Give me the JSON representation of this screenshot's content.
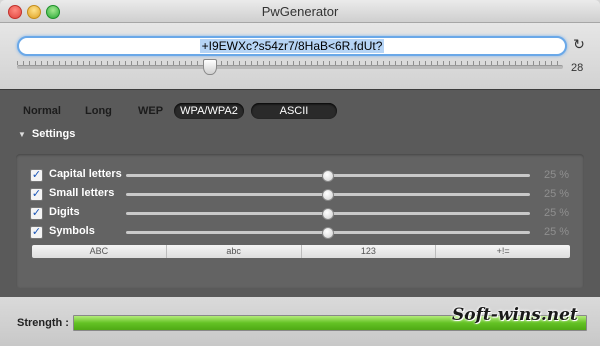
{
  "window": {
    "title": "PwGenerator"
  },
  "password": {
    "value": "+I9EWXc?s54zr7/8HaB<6R.fdUt?"
  },
  "length": {
    "value": "28",
    "fraction": 0.35
  },
  "modes": {
    "normal": "Normal",
    "long": "Long",
    "wep": "WEP",
    "wpa": "WPA/WPA2",
    "ascii": "ASCII"
  },
  "settings": {
    "title": "Settings",
    "rows": [
      {
        "label": "Capital letters",
        "checked": true,
        "percent": "25 %",
        "fraction": 0.5
      },
      {
        "label": "Small letters",
        "checked": true,
        "percent": "25 %",
        "fraction": 0.5
      },
      {
        "label": "Digits",
        "checked": true,
        "percent": "25 %",
        "fraction": 0.5
      },
      {
        "label": "Symbols",
        "checked": true,
        "percent": "25 %",
        "fraction": 0.5
      }
    ],
    "char_sets": [
      "ABC",
      "abc",
      "123",
      "+!="
    ]
  },
  "strength": {
    "label": "Strength :",
    "fraction": 1.0,
    "color": "#63c224"
  },
  "watermark": "Soft-wins.net",
  "colors": {
    "accent": "#6aa8e8",
    "check": "#1b56b8",
    "panel": "#5a5a5a"
  }
}
